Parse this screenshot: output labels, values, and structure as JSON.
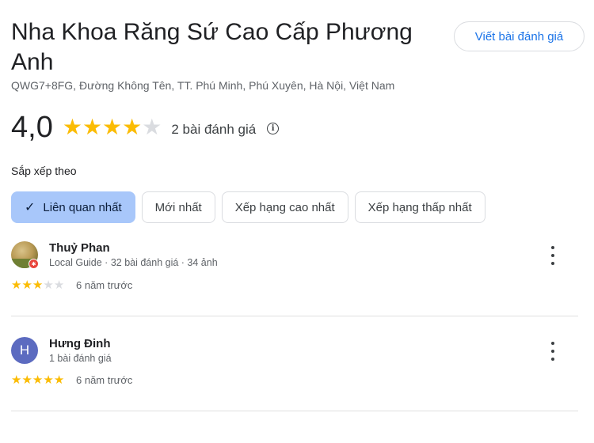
{
  "place": {
    "title": "Nha Khoa Răng Sứ Cao Cấp Phương Anh",
    "address": "QWG7+8FG, Đường Không Tên, TT. Phú Minh, Phú Xuyên, Hà Nội, Việt Nam",
    "write_review_label": "Viết bài đánh giá"
  },
  "rating": {
    "value": "4,0",
    "stars": 4,
    "out_of": 5,
    "count_label": "2 bài đánh giá",
    "info_icon": "info-icon"
  },
  "sort": {
    "label": "Sắp xếp theo",
    "options": [
      {
        "label": "Liên quan nhất",
        "selected": true
      },
      {
        "label": "Mới nhất",
        "selected": false
      },
      {
        "label": "Xếp hạng cao nhất",
        "selected": false
      },
      {
        "label": "Xếp hạng thấp nhất",
        "selected": false
      }
    ]
  },
  "reviews": [
    {
      "name": "Thuỷ Phan",
      "meta": "Local Guide · 32 bài đánh giá · 34 ảnh",
      "stars": 3,
      "time": "6 năm trước",
      "avatar": "photo"
    },
    {
      "name": "Hưng Đinh",
      "meta": "1 bài đánh giá",
      "stars": 5,
      "time": "6 năm trước",
      "avatar_letter": "H"
    }
  ],
  "colors": {
    "star_on": "#fbbc04",
    "star_off": "#dadce0",
    "accent": "#1a73e8",
    "chip_active": "#a8c7fa",
    "avatar_letter_bg": "#5c6bc0"
  }
}
